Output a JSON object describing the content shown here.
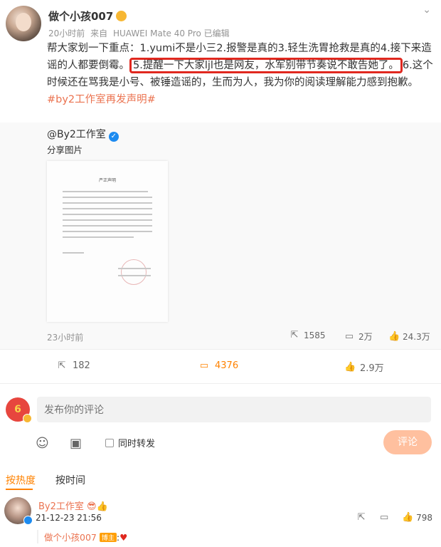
{
  "post": {
    "username": "做个小孩007",
    "time": "20小时前",
    "source_prefix": "来自",
    "device": "HUAWEI Mate 40 Pro",
    "edited": "已编辑",
    "text_before": "帮大家划一下重点：1.yumi不是小三2.报警是真的3.轻生洗胃抢救是真的4.接下来造谣的人都要倒霉。",
    "text_highlight": "5.提醒一下大家ljl也是网友，水军别带节奏说不敢告她了。",
    "text_after": "6.这个时候还在骂我是小号、被锤造谣的，生而为人，我为你的阅读理解能力感到抱歉。",
    "hashtag": "#by2工作室再发声明#"
  },
  "repost": {
    "author": "@By2工作室",
    "subtitle": "分享图片",
    "doc_title": "严正声明",
    "time": "23小时前",
    "shares": "1585",
    "comments": "2万",
    "likes": "24.3万"
  },
  "actions": {
    "share": "182",
    "comment": "4376",
    "like": "2.9万"
  },
  "composer": {
    "avatar_text": "6",
    "placeholder": "发布你的评论",
    "repost_label": "同时转发",
    "submit_label": "评论"
  },
  "sort": {
    "hot": "按热度",
    "time": "按时间"
  },
  "comment": {
    "author": "By2工作室",
    "time": "21-12-23 21:56",
    "likes": "798",
    "reply_author": "做个小孩007",
    "reply_badge": "博主",
    "reply_text": ":"
  },
  "colors": {
    "accent": "#ff8200",
    "link": "#eb7350",
    "highlight_border": "#e0281f"
  }
}
